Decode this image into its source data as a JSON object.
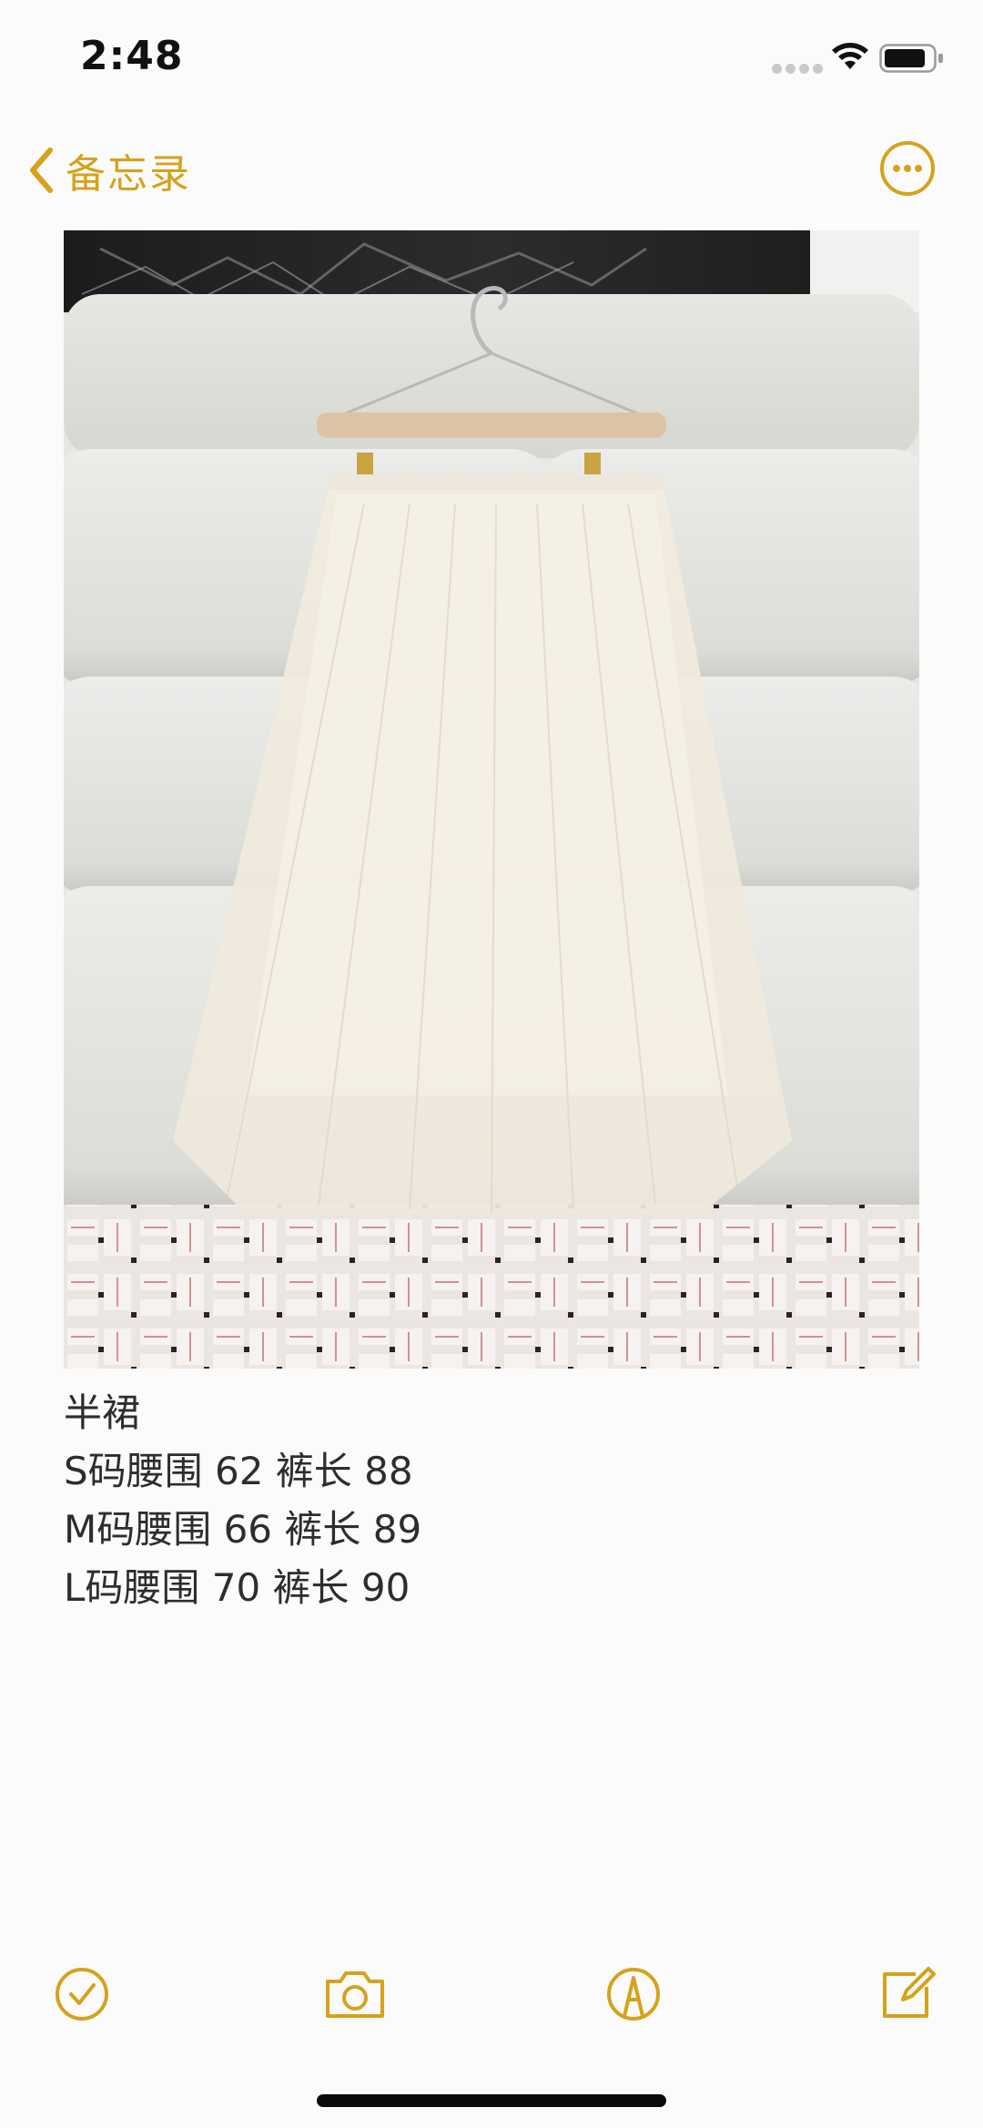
{
  "status_bar": {
    "time": "2:48",
    "icons": [
      "signal-icon",
      "wifi-icon",
      "battery-icon"
    ]
  },
  "nav": {
    "back_label": "备忘录",
    "back_icon": "chevron-left-icon",
    "more_icon": "more-ellipsis-icon"
  },
  "note": {
    "image": "skirt-photo",
    "lines": [
      "半裙",
      "S码腰围 62 裤长 88",
      "M码腰围 66 裤长 89",
      "L码腰围 70 裤长 90"
    ]
  },
  "toolbar": {
    "items": [
      "checklist-icon",
      "camera-icon",
      "markup-icon",
      "compose-icon"
    ]
  },
  "colors": {
    "accent": "#d6a21c",
    "background": "#fcfbfc",
    "text": "#2d2d2d"
  }
}
